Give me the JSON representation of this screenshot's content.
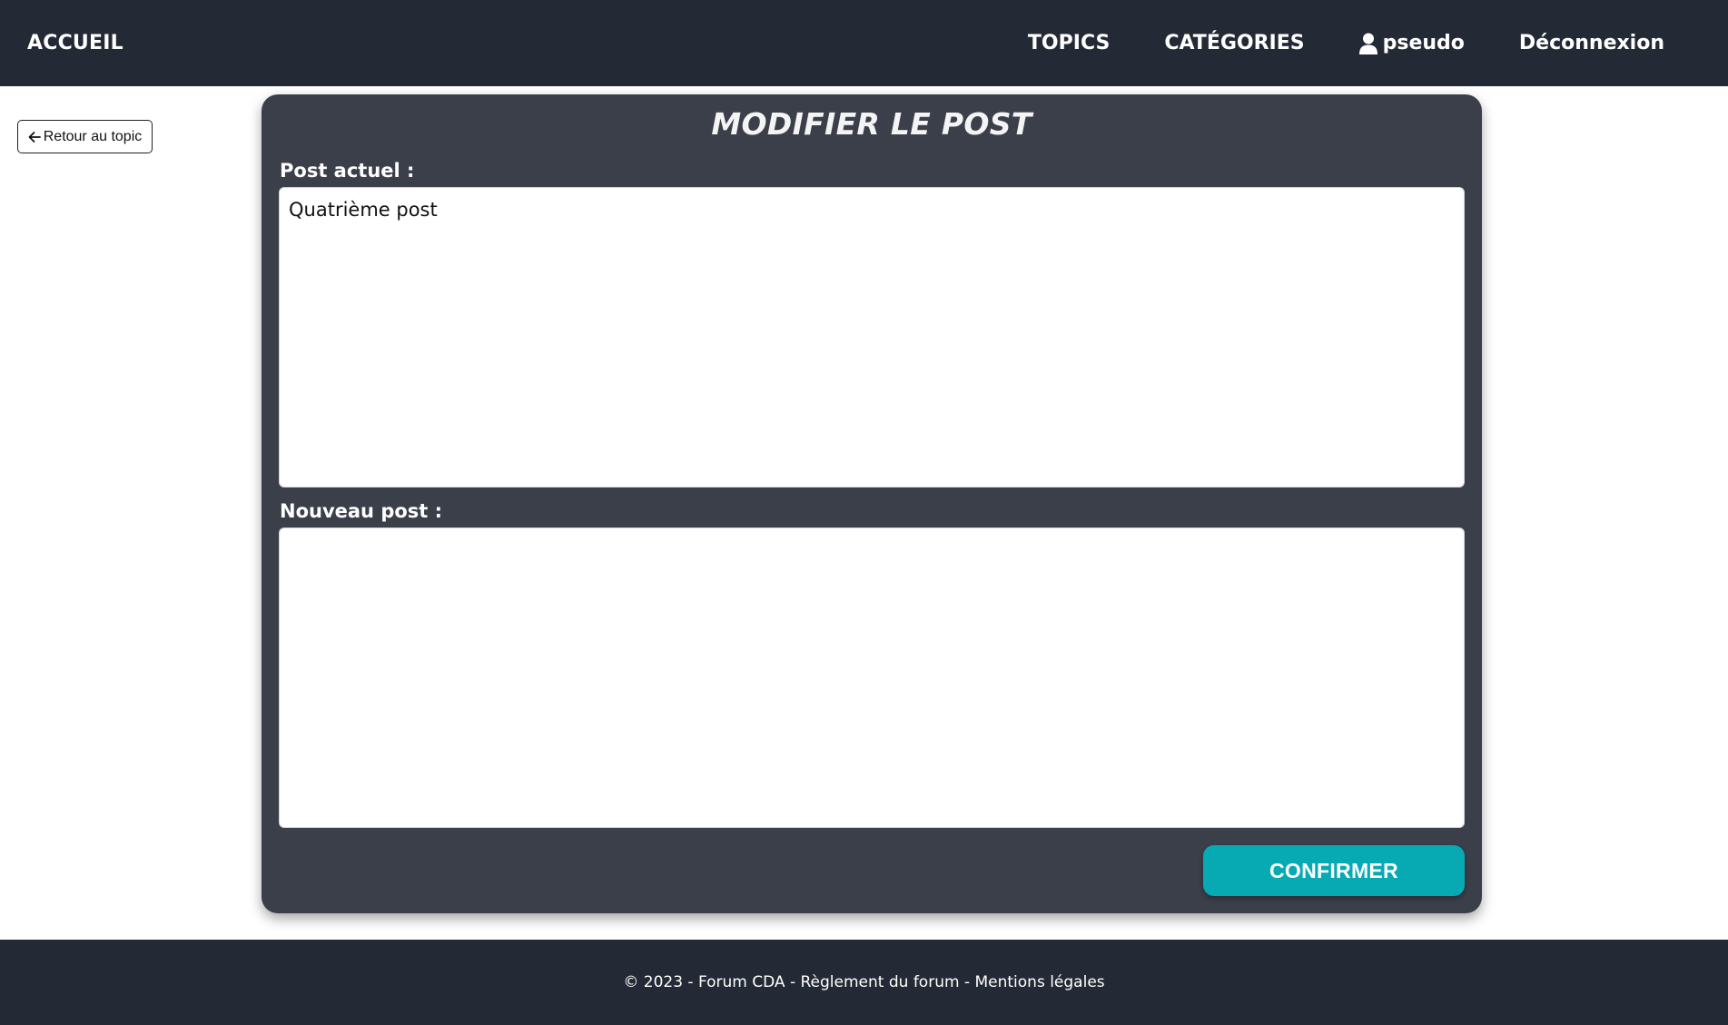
{
  "nav": {
    "brand": "ACCUEIL",
    "topics": "TOPICS",
    "categories": "CATÉGORIES",
    "user_icon": "user-icon",
    "username": "pseudo",
    "logout": "Déconnexion"
  },
  "back": {
    "icon": "arrow-left-icon",
    "label": "Retour au topic"
  },
  "form": {
    "title": "MODIFIER LE POST",
    "current_label": "Post actuel :",
    "current_value": "Quatrième post",
    "new_label": "Nouveau post :",
    "new_value": "",
    "confirm_label": "CONFIRMER"
  },
  "footer": {
    "copyright": "© 2023 - Forum CDA - ",
    "sep": " - ",
    "rules_link": "Règlement du forum",
    "legal_link": "Mentions légales"
  },
  "colors": {
    "navbar_bg": "#242a35",
    "card_bg": "#3a3f4a",
    "accent": "#07aab3"
  }
}
